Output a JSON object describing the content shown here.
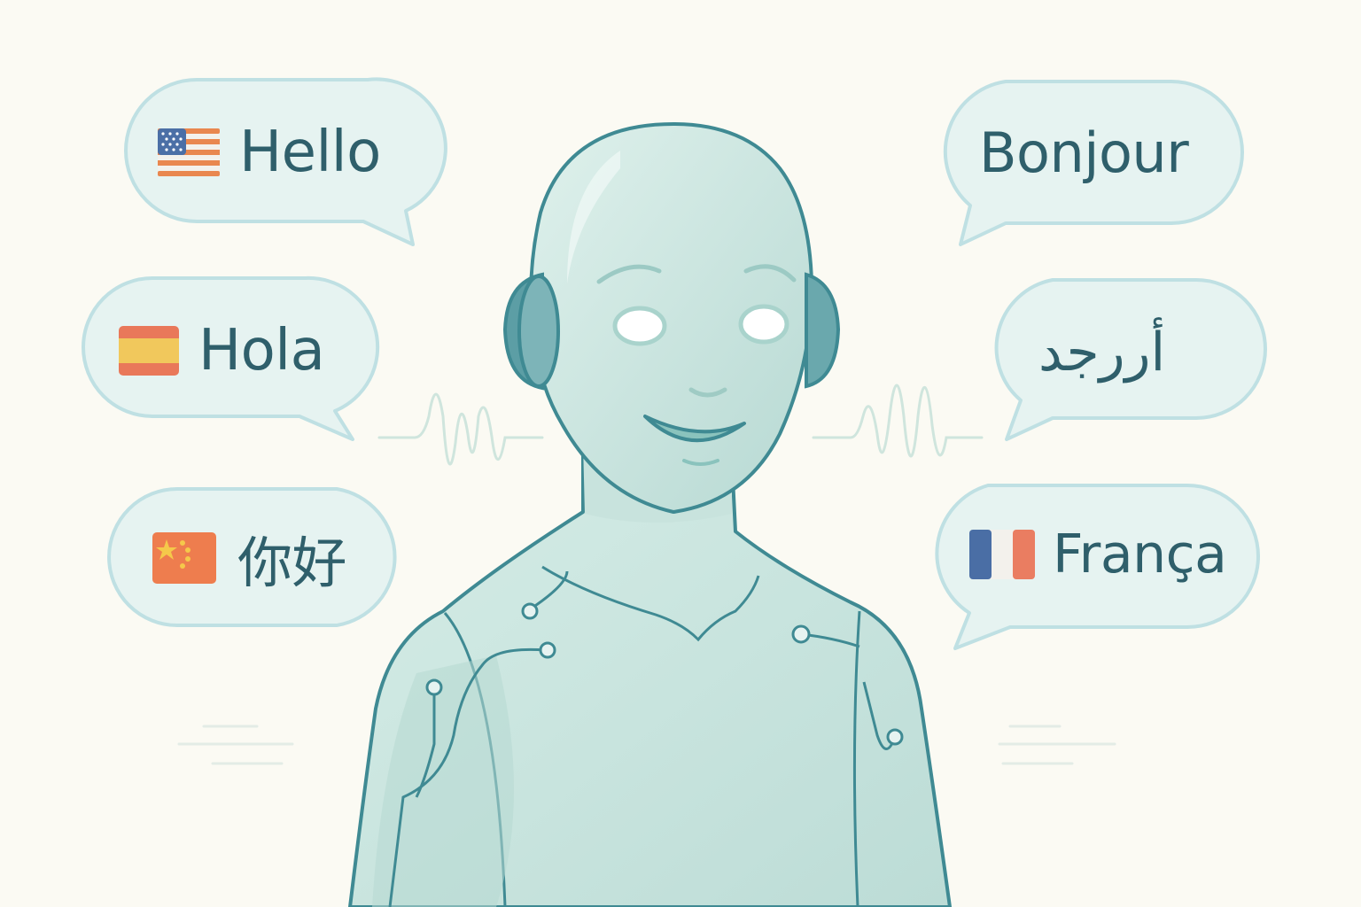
{
  "bubbles": {
    "english": {
      "text": "Hello",
      "flag_icon": "us-flag-icon"
    },
    "spanish": {
      "text": "Hola",
      "flag_icon": "spain-flag-icon"
    },
    "chinese": {
      "text": "你好",
      "flag_icon": "china-flag-icon"
    },
    "french_bonjour": {
      "text": "Bonjour"
    },
    "arabic": {
      "text": "أررجد"
    },
    "french_franca": {
      "text": "França",
      "flag_icon": "france-flag-icon"
    }
  },
  "colors": {
    "background": "#fbfaf3",
    "bubble_fill": "#e6f3f1",
    "bubble_stroke": "#bfe0e3",
    "text": "#2f5f6b",
    "figure_fill": "#cfe8e2",
    "figure_stroke": "#3f8a93",
    "headphone": "#5c9ea5"
  }
}
